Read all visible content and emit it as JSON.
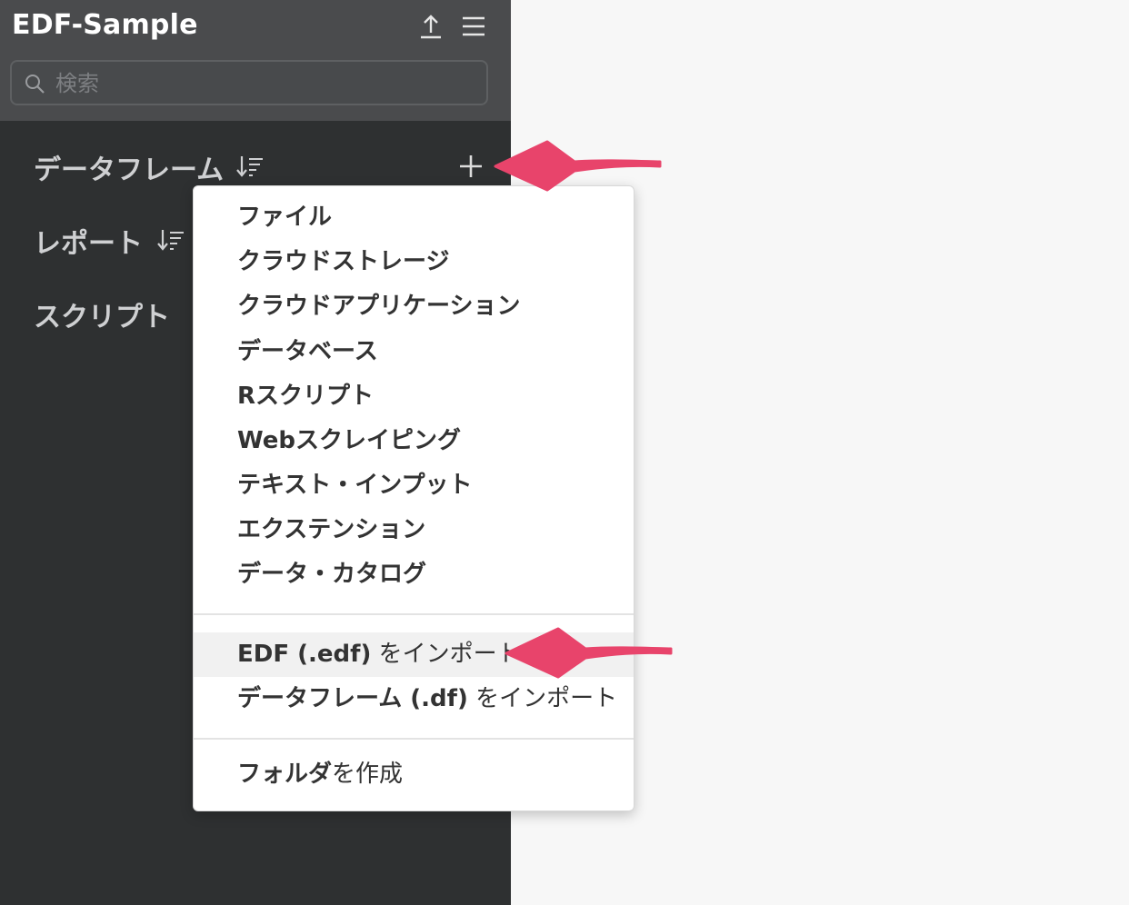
{
  "sidebar": {
    "title": "EDF-Sample",
    "header_icons": [
      "upload-icon",
      "hamburger-menu-icon"
    ],
    "search": {
      "placeholder": "検索",
      "value": ""
    },
    "sections": [
      {
        "label": "データフレーム",
        "has_sort": true,
        "has_add": true
      },
      {
        "label": "レポート",
        "has_sort": true
      },
      {
        "label": "スクリプト"
      }
    ]
  },
  "menu": {
    "group1": [
      "ファイル",
      "クラウドストレージ",
      "クラウドアプリケーション",
      "データベース",
      "Rスクリプト",
      "Webスクレイピング",
      "テキスト・インプット",
      "エクステンション",
      "データ・カタログ"
    ],
    "group2": [
      {
        "bold": "EDF (.edf)",
        "normal": " をインポート",
        "highlighted": true
      },
      {
        "bold": "データフレーム (.df)",
        "normal": " をインポート"
      }
    ],
    "group3": [
      {
        "bold": "フォルダ",
        "normal": "を作成"
      }
    ]
  },
  "colors": {
    "sidebar_bg": "#2e3031",
    "header_bg": "#4a4b4d",
    "arrow": "#e8446b",
    "content_bg": "#f7f7f7"
  }
}
